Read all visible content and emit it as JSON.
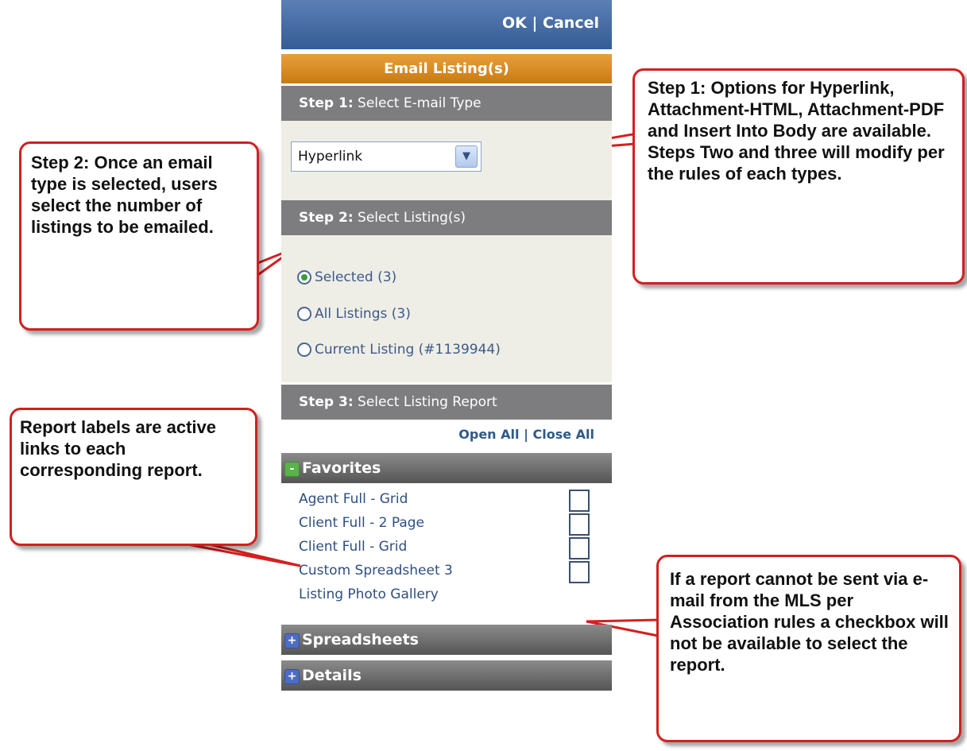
{
  "header": {
    "ok_label": "OK",
    "separator": "|",
    "cancel_label": "Cancel"
  },
  "title": "Email Listing(s)",
  "step1": {
    "label_bold": "Step 1:",
    "label_rest": " Select E-mail Type",
    "select_value": "Hyperlink"
  },
  "step2": {
    "label_bold": "Step 2:",
    "label_rest": " Select Listing(s)",
    "options": [
      {
        "label": "Selected (3)",
        "checked": true
      },
      {
        "label": "All Listings (3)",
        "checked": false
      },
      {
        "label": "Current Listing (#1139944)",
        "checked": false
      }
    ]
  },
  "step3": {
    "label_bold": "Step 3:",
    "label_rest": " Select Listing Report",
    "open_all": "Open All",
    "separator": "|",
    "close_all": "Close All"
  },
  "categories": {
    "favorites": {
      "label": "Favorites",
      "toggle": "-"
    },
    "spreadsheets": {
      "label": "Spreadsheets",
      "toggle": "+"
    },
    "details": {
      "label": "Details",
      "toggle": "+"
    }
  },
  "reports": [
    {
      "label": "Agent Full - Grid",
      "has_checkbox": true
    },
    {
      "label": "Client Full - 2 Page",
      "has_checkbox": true
    },
    {
      "label": "Client Full - Grid",
      "has_checkbox": true
    },
    {
      "label": "Custom Spreadsheet 3",
      "has_checkbox": true
    },
    {
      "label": "Listing Photo Gallery",
      "has_checkbox": false
    }
  ],
  "callouts": {
    "step1": "Step 1: Options for Hyperlink, Attachment-HTML, Attachment-PDF and Insert Into Body are available. Steps Two and three will modify per the rules of each types.",
    "step2": "Step 2: Once an email type is selected, users select the number of listings to be emailed.",
    "reports": "Report labels are active links to each corresponding report.",
    "checkbox": "If a report cannot be sent via e-mail from the MLS per Association rules a checkbox will not be available to select the report."
  },
  "colors": {
    "header_blue": "#355c95",
    "title_orange": "#d88d22",
    "step_grey": "#7d7d7f",
    "callout_red": "#d41f1f",
    "link_blue": "#2f4f80"
  }
}
